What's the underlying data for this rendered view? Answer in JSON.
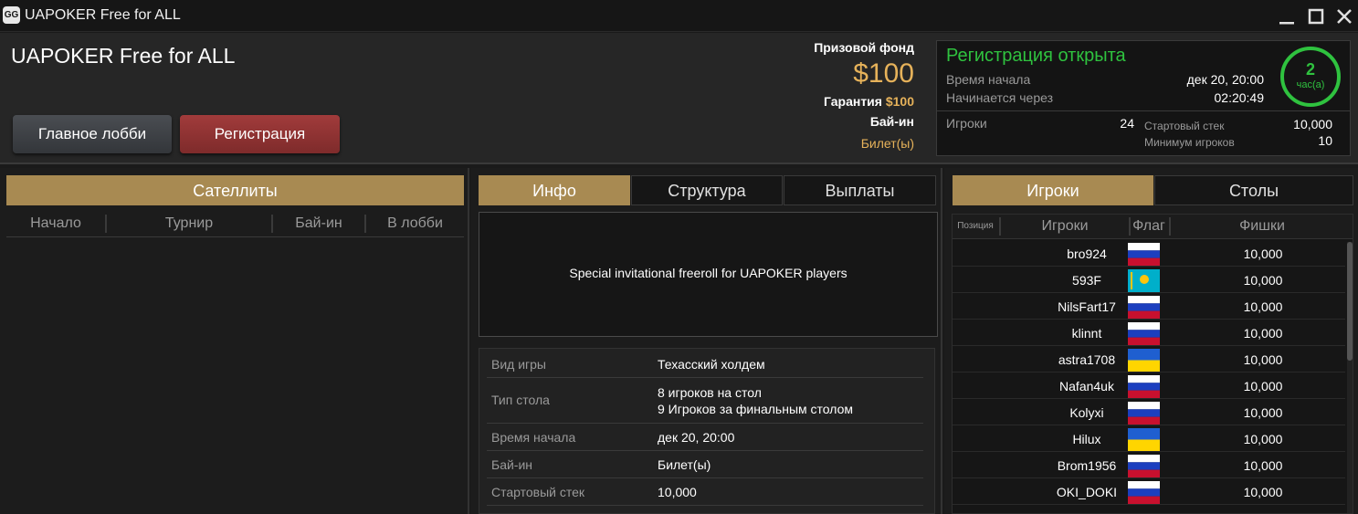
{
  "window": {
    "title": "UAPOKER Free for ALL",
    "app_icon": "GG"
  },
  "header": {
    "tournament_name": "UAPOKER Free for ALL",
    "lobby_button": "Главное лобби",
    "register_button": "Регистрация",
    "prize_pool_label": "Призовой фонд",
    "prize_pool_value": "$100",
    "guarantee_label": "Гарантия",
    "guarantee_value": "$100",
    "buyin_label": "Бай-ин",
    "buyin_value": "Билет(ы)"
  },
  "registration": {
    "status": "Регистрация открыта",
    "start_time_label": "Время начала",
    "start_time_value": "дек 20, 20:00",
    "starts_in_label": "Начинается через",
    "starts_in_value": "02:20:49",
    "countdown_number": "2",
    "countdown_unit": "час(а)",
    "players_label": "Игроки",
    "players_value": "24",
    "starting_stack_label": "Стартовый стек",
    "starting_stack_value": "10,000",
    "min_players_label": "Минимум игроков",
    "min_players_value": "10"
  },
  "satellites": {
    "tab": "Сателлиты",
    "columns": [
      "Начало",
      "Турнир",
      "Бай-ин",
      "В лобби"
    ]
  },
  "info_panel": {
    "tabs": [
      "Инфо",
      "Структура",
      "Выплаты"
    ],
    "description": "Special invitational freeroll for UAPOKER players",
    "rows": [
      {
        "key": "Вид игры",
        "value": "Техасский холдем"
      },
      {
        "key": "Тип стола",
        "value": "8 игроков на стол",
        "value2": "9 Игроков за финальным столом"
      },
      {
        "key": "Время начала",
        "value": "дек 20, 20:00"
      },
      {
        "key": "Бай-ин",
        "value": "Билет(ы)"
      },
      {
        "key": "Стартовый стек",
        "value": "10,000"
      }
    ]
  },
  "players_panel": {
    "tabs": [
      "Игроки",
      "Столы"
    ],
    "columns": [
      "Позиция",
      "Игроки",
      "Флаг",
      "Фишки"
    ],
    "players": [
      {
        "name": "bro924",
        "flag": "russia-flag",
        "chips": "10,000"
      },
      {
        "name": "593F",
        "flag": "kazakhstan-flag",
        "chips": "10,000"
      },
      {
        "name": "NilsFart17",
        "flag": "russia-flag",
        "chips": "10,000"
      },
      {
        "name": "klinnt",
        "flag": "russia-flag",
        "chips": "10,000"
      },
      {
        "name": "astra1708",
        "flag": "ukraine-flag",
        "chips": "10,000"
      },
      {
        "name": "Nafan4uk",
        "flag": "russia-flag",
        "chips": "10,000"
      },
      {
        "name": "Kolyxi",
        "flag": "russia-flag",
        "chips": "10,000"
      },
      {
        "name": "Hilux",
        "flag": "ukraine-flag",
        "chips": "10,000"
      },
      {
        "name": "Brom1956",
        "flag": "russia-flag",
        "chips": "10,000"
      },
      {
        "name": "OKI_DOKI",
        "flag": "russia-flag",
        "chips": "10,000"
      }
    ]
  },
  "colors": {
    "accent_gold": "#a88a52",
    "prize_gold": "#e6b25a",
    "green": "#2fc23f",
    "register_red": "#a13b3b"
  }
}
